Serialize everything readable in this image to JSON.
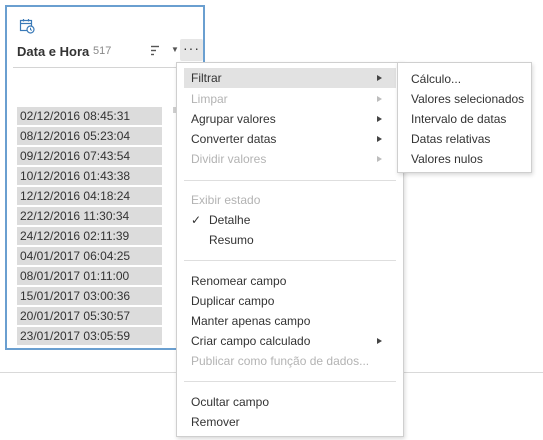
{
  "field": {
    "name": "Data e Hora",
    "count": "517",
    "icon": "calendar-clock-icon",
    "values": [
      "02/12/2016 08:45:31",
      "08/12/2016 05:23:04",
      "09/12/2016 07:43:54",
      "10/12/2016 01:43:38",
      "12/12/2016 04:18:24",
      "22/12/2016 11:30:34",
      "24/12/2016 02:11:39",
      "04/01/2017 06:04:25",
      "08/01/2017 01:11:00",
      "15/01/2017 03:00:36",
      "20/01/2017 05:30:57",
      "23/01/2017 03:05:59"
    ]
  },
  "menu": {
    "filtrar": "Filtrar",
    "limpar": "Limpar",
    "agrupar": "Agrupar valores",
    "converter": "Converter datas",
    "dividir": "Dividir valores",
    "exibir_estado": "Exibir estado",
    "detalhe": "Detalhe",
    "resumo": "Resumo",
    "renomear": "Renomear campo",
    "duplicar": "Duplicar campo",
    "manter": "Manter apenas campo",
    "criar_calc": "Criar campo calculado",
    "publicar": "Publicar como função de dados...",
    "ocultar": "Ocultar campo",
    "remover": "Remover",
    "check_mark": "✓"
  },
  "submenu": {
    "calculo": "Cálculo...",
    "valores_sel": "Valores selecionados",
    "intervalo": "Intervalo de datas",
    "relativas": "Datas relativas",
    "nulos": "Valores nulos"
  },
  "colors": {
    "card_border": "#6a9fd0",
    "value_bg": "#dcdcdc",
    "selected_bg": "#e2e2e2",
    "disabled_text": "#b3b3b3"
  }
}
